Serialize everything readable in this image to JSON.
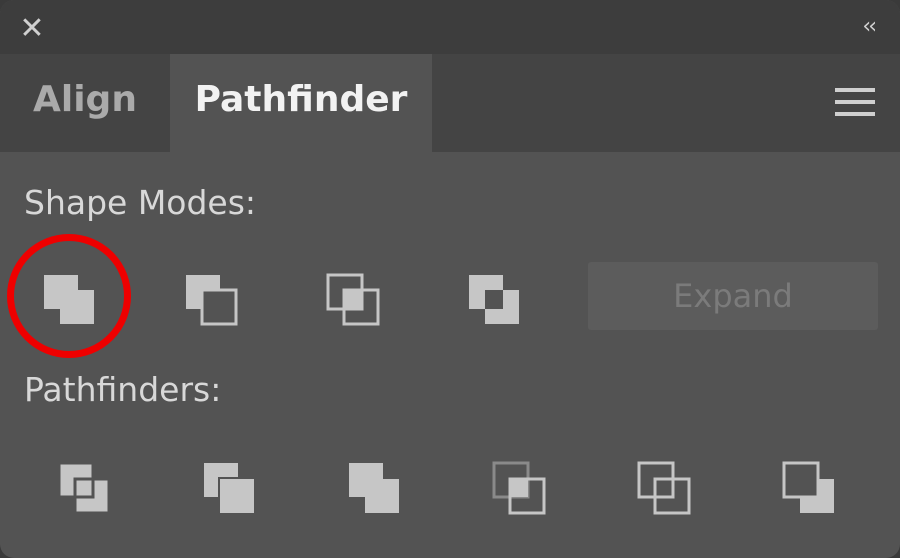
{
  "window": {
    "close_glyph": "✕",
    "collapse_glyph": "‹‹"
  },
  "tabs": [
    {
      "label": "Align",
      "active": false
    },
    {
      "label": "Pathfinder",
      "active": true
    }
  ],
  "menu_icon": "hamburger-menu-icon",
  "shape_modes": {
    "label": "Shape Modes:",
    "buttons": [
      "unite-icon",
      "minus-front-icon",
      "intersect-icon",
      "exclude-icon"
    ],
    "expand_label": "Expand",
    "expand_enabled": false,
    "highlighted_button": "unite-icon",
    "highlight_color": "#ee0000"
  },
  "pathfinders": {
    "label": "Pathfinders:",
    "buttons": [
      "divide-icon",
      "trim-icon",
      "merge-icon",
      "crop-icon",
      "outline-icon",
      "minus-back-icon"
    ]
  }
}
